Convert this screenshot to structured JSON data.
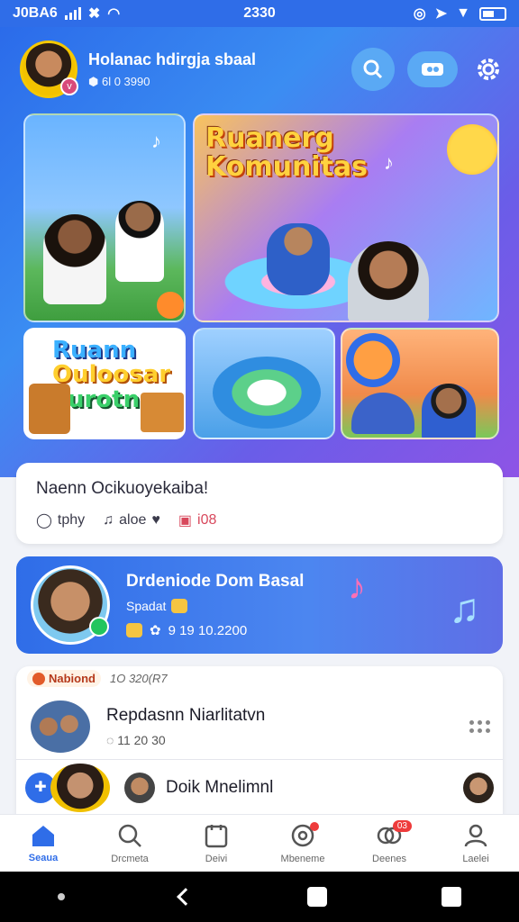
{
  "status_bar": {
    "carrier": "J0BA6",
    "time": "2330"
  },
  "profile": {
    "name": "Holanac hdirgja sbaal",
    "meta": "6l 0 3990",
    "badge": "v"
  },
  "banner": {
    "tile_b_title_line1": "Ruanerg",
    "tile_b_title_line2": "Komunitas",
    "tile_c_title_line1": "Ruann",
    "tile_c_title_line2": "Ouloosar",
    "tile_c_title_line3": "vurotnn"
  },
  "status_card": {
    "title": "Naenn Ocikuoyekaiba!",
    "stat1": "tphy",
    "stat2": "aloe",
    "stat3": "i08"
  },
  "dj_card": {
    "title": "Drdeniode Dom Basal",
    "subtitle": "Spadat",
    "meta": "9 19 10.2200"
  },
  "list": {
    "badge": "Nabiond",
    "time": "1O 320(R7",
    "row1_title": "Repdasnn Niarlitatvn",
    "row1_meta": "11 20 30",
    "row2_title": "Doik Mnelimnl"
  },
  "bottom_nav": [
    {
      "label": "Seaua",
      "icon": "home-icon"
    },
    {
      "label": "Drcmeta",
      "icon": "search-icon"
    },
    {
      "label": "Deivi",
      "icon": "calendar-icon"
    },
    {
      "label": "Mbeneme",
      "icon": "target-icon"
    },
    {
      "label": "Deenes",
      "icon": "chat-icon",
      "badge": "03"
    },
    {
      "label": "Laelei",
      "icon": "profile-icon"
    }
  ],
  "colors": {
    "primary": "#2f6de8",
    "accent": "#ffd23f",
    "badge": "#ee3b3b"
  }
}
